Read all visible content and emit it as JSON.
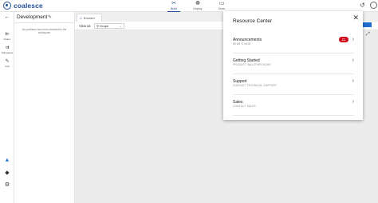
{
  "app": {
    "name": "coalesce"
  },
  "nav": {
    "tabs": [
      {
        "label": "Build",
        "icon": "build-icon",
        "active": true
      },
      {
        "label": "Deploy",
        "icon": "deploy-icon",
        "active": false
      },
      {
        "label": "Docs",
        "icon": "docs-icon",
        "active": false
      }
    ]
  },
  "rail": {
    "items": [
      {
        "label": "Nodes",
        "icon": "nodes-icon"
      },
      {
        "label": "Subgraphs",
        "icon": "subgraphs-icon"
      },
      {
        "label": "Jobs",
        "icon": "jobs-icon"
      }
    ]
  },
  "workspace": {
    "title": "Development",
    "empty_text": "No problems have been detected in the workspace"
  },
  "main": {
    "tab_label": "Browser",
    "view_as_label": "View as",
    "graph_option": "Graph",
    "tabs_button": "Tabs"
  },
  "resource_center": {
    "title": "Resource Center",
    "items": [
      {
        "label": "Announcements",
        "sub": "WHAT'S NEW",
        "badge": "21"
      },
      {
        "label": "Getting Started",
        "sub": "PRODUCT WALKTHROUGHS"
      },
      {
        "label": "Support",
        "sub": "CONTACT TECHNICAL SUPPORT"
      },
      {
        "label": "Sales",
        "sub": "CONTACT SALES"
      }
    ]
  },
  "colors": {
    "brand": "#1f4e96",
    "badge": "#d0021b",
    "accent": "#1f6fd1"
  }
}
